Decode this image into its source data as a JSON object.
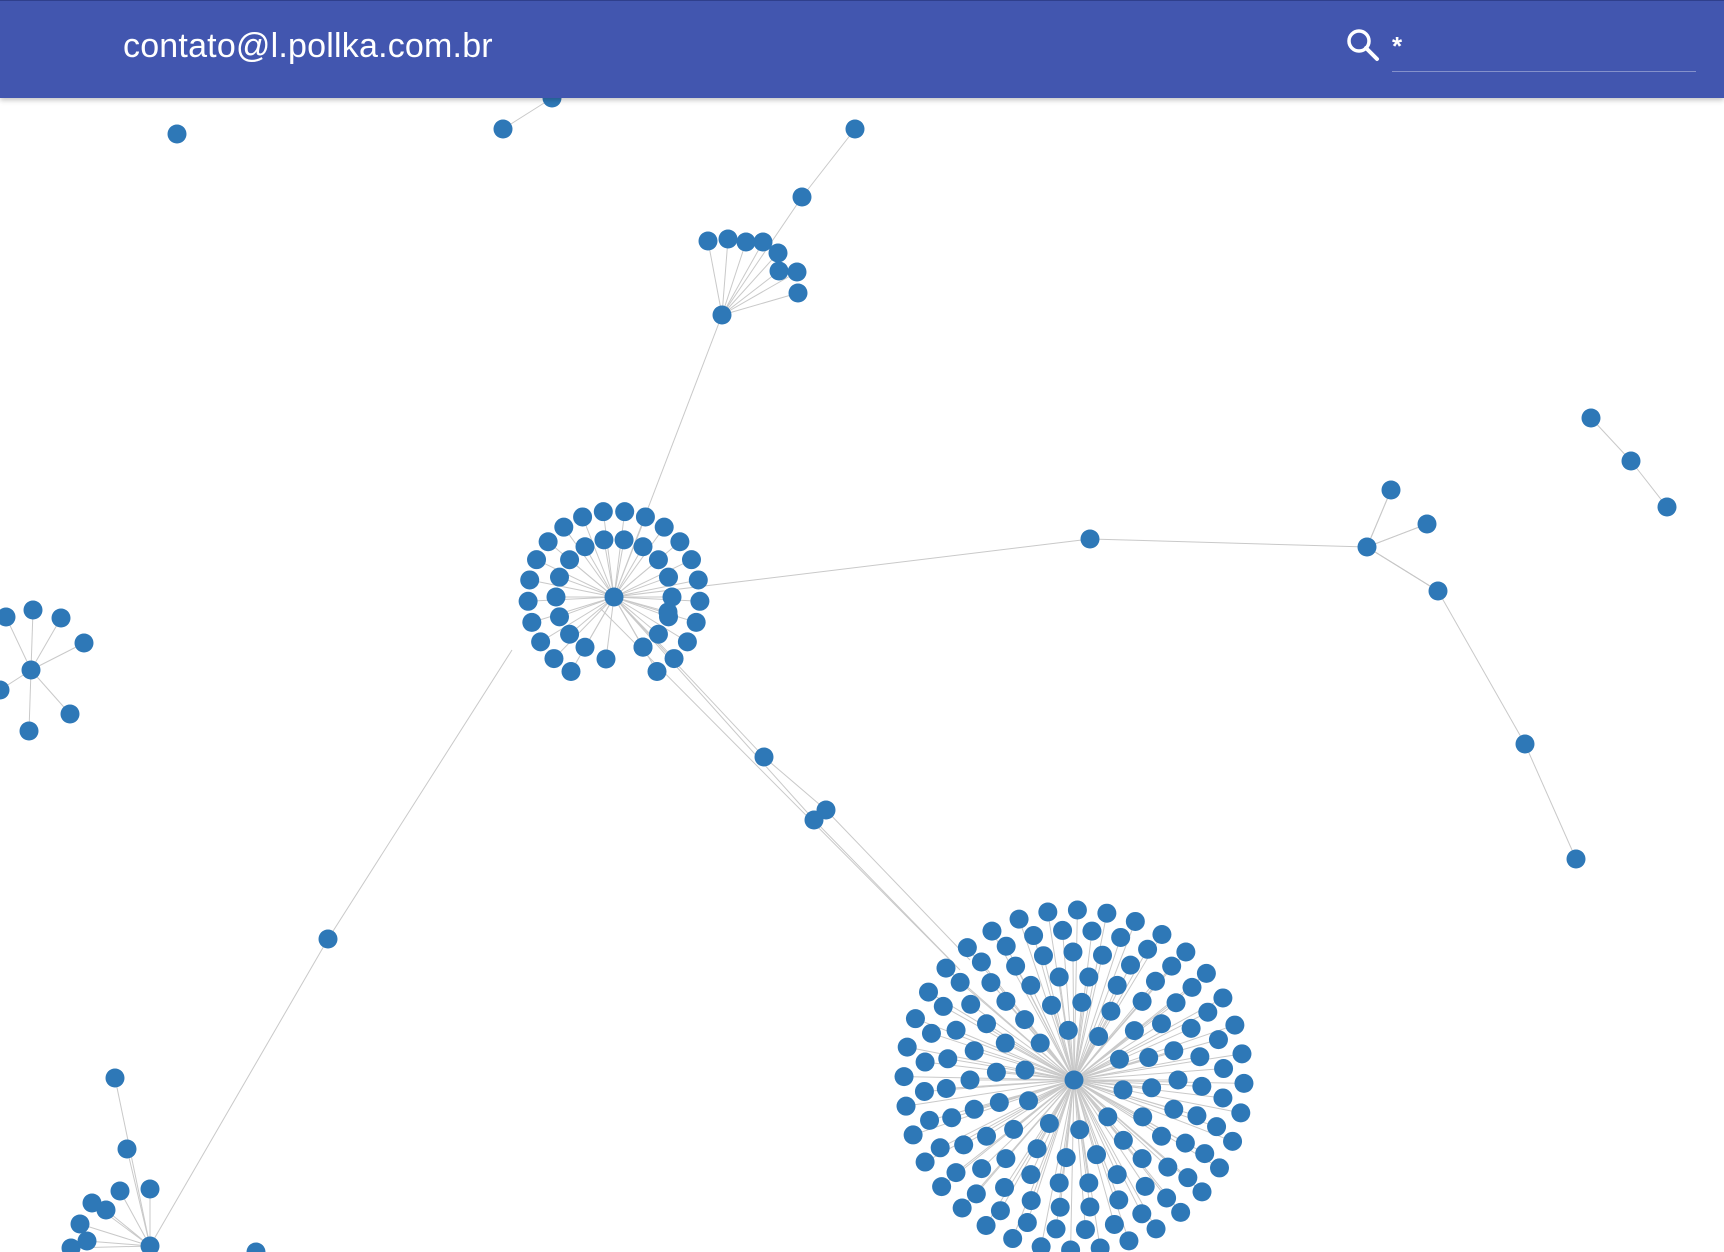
{
  "app": {
    "title": "contato@l.pollka.com.br"
  },
  "search": {
    "value": "*",
    "icon": "search-icon"
  },
  "colors": {
    "toolbar": "#4256af",
    "node": "#2e78b7",
    "edge": "#c9c9c9"
  },
  "graph": {
    "type": "force-directed network",
    "visible_nodes_approx": 350
  }
}
